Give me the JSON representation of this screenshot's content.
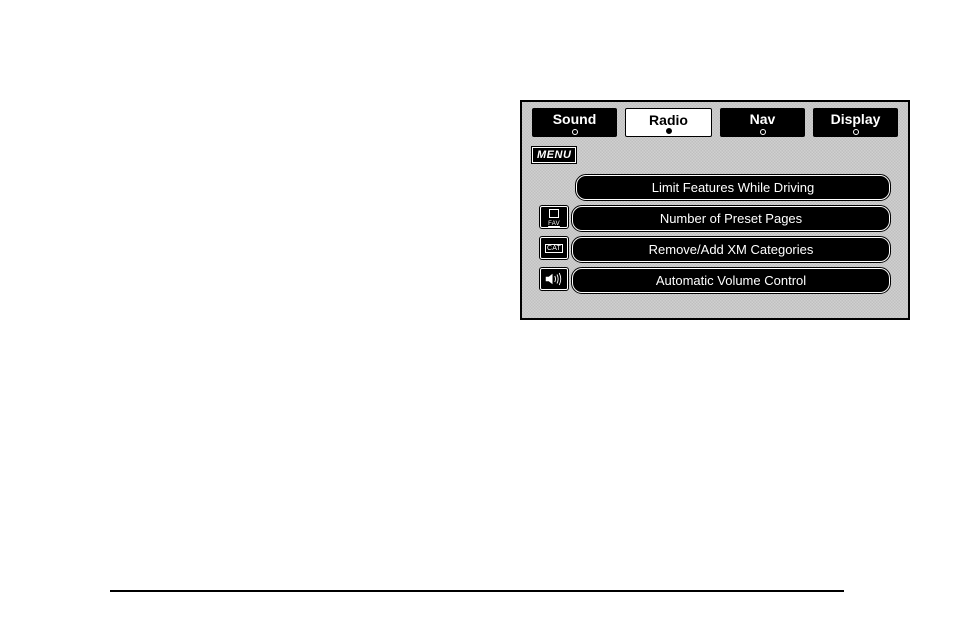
{
  "tabs": [
    {
      "label": "Sound",
      "selected": false
    },
    {
      "label": "Radio",
      "selected": true
    },
    {
      "label": "Nav",
      "selected": false
    },
    {
      "label": "Display",
      "selected": false
    }
  ],
  "menu_label": "MENU",
  "options": [
    {
      "icon": null,
      "label": "Limit Features While Driving"
    },
    {
      "icon": "fav",
      "icon_text": "FAV",
      "label": "Number of Preset Pages"
    },
    {
      "icon": "cat",
      "icon_text": "CAT",
      "label": "Remove/Add XM Categories"
    },
    {
      "icon": "speaker",
      "label": "Automatic Volume Control"
    }
  ]
}
